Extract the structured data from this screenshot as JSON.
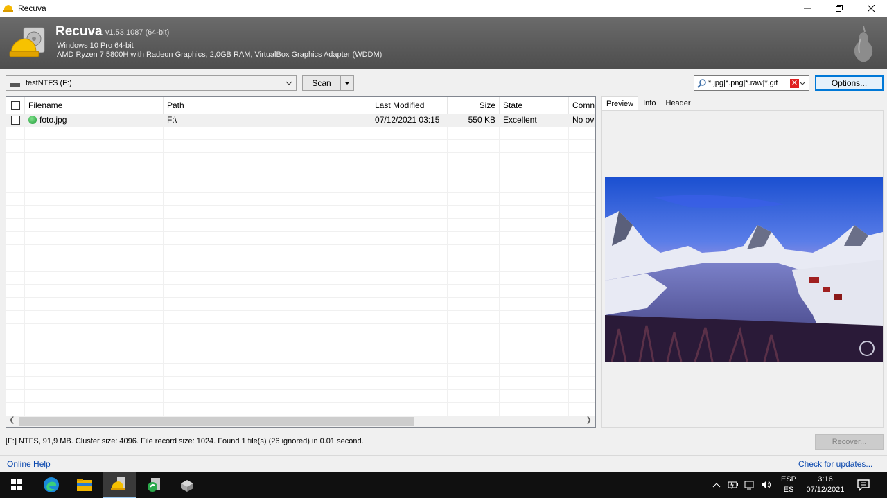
{
  "window": {
    "title": "Recuva"
  },
  "header": {
    "app_name": "Recuva",
    "version": "v1.53.1087 (64-bit)",
    "os_line": "Windows 10 Pro 64-bit",
    "hardware_line": "AMD Ryzen 7 5800H with Radeon Graphics, 2,0GB RAM, VirtualBox Graphics Adapter (WDDM)"
  },
  "toolbar": {
    "drive": "testNTFS (F:)",
    "scan_label": "Scan",
    "filter_text": "*.jpg|*.png|*.raw|*.gif",
    "options_label": "Options..."
  },
  "table": {
    "columns": [
      "Filename",
      "Path",
      "Last Modified",
      "Size",
      "State",
      "Comn"
    ],
    "rows": [
      {
        "filename": "foto.jpg",
        "path": "F:\\",
        "modified": "07/12/2021 03:15",
        "size": "550 KB",
        "state": "Excellent",
        "comment": "No ov",
        "state_color": "#2ea043"
      }
    ]
  },
  "preview": {
    "tabs": [
      "Preview",
      "Info",
      "Header"
    ],
    "active_tab": "Preview"
  },
  "status": {
    "text": "[F:] NTFS, 91,9 MB. Cluster size: 4096. File record size: 1024. Found 1 file(s) (26 ignored) in 0.01 second.",
    "recover_label": "Recover..."
  },
  "footer": {
    "online_help": "Online Help",
    "check_updates": "Check for updates..."
  },
  "taskbar": {
    "apps": [
      "start-icon",
      "edge-icon",
      "file-explorer-icon",
      "recuva-icon",
      "ccleaner-icon",
      "installer-icon"
    ],
    "lang_top": "ESP",
    "lang_bottom": "ES",
    "time": "3:16",
    "date": "07/12/2021"
  }
}
